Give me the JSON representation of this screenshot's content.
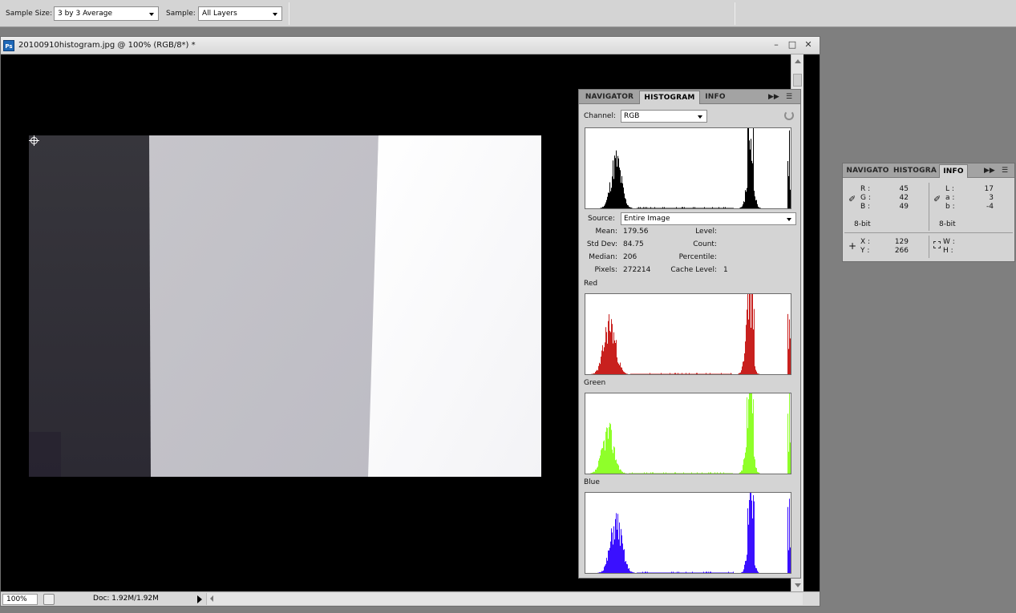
{
  "options_bar": {
    "sample_size_label": "Sample Size:",
    "sample_size_value": "3 by 3 Average",
    "sample_label": "Sample:",
    "sample_value": "All Layers"
  },
  "document": {
    "title": "20100910histogram.jpg @ 100% (RGB/8*) *",
    "app_icon": "Ps",
    "zoom": "100%",
    "doc_info": "Doc: 1.92M/1.92M"
  },
  "histogram_panel": {
    "tabs": [
      "NAVIGATOR",
      "HISTOGRAM",
      "INFO"
    ],
    "active_tab": "HISTOGRAM",
    "channel_label": "Channel:",
    "channel_value": "RGB",
    "source_label": "Source:",
    "source_value": "Entire Image",
    "stats": {
      "mean_label": "Mean:",
      "mean": "179.56",
      "stddev_label": "Std Dev:",
      "stddev": "84.75",
      "median_label": "Median:",
      "median": "206",
      "pixels_label": "Pixels:",
      "pixels": "272214",
      "level_label": "Level:",
      "count_label": "Count:",
      "percentile_label": "Percentile:",
      "cache_label": "Cache Level:",
      "cache": "1"
    },
    "channel_titles": {
      "red": "Red",
      "green": "Green",
      "blue": "Blue"
    },
    "colors": {
      "rgb": "#000000",
      "red": "#c8201e",
      "green": "#8fff2a",
      "blue": "#3a10ff"
    }
  },
  "info_panel": {
    "tabs": [
      "NAVIGATO",
      "HISTOGRA",
      "INFO"
    ],
    "active_tab": "INFO",
    "rgb": {
      "r_label": "R :",
      "r": "45",
      "g_label": "G :",
      "g": "42",
      "b_label": "B :",
      "b": "49",
      "depth": "8-bit"
    },
    "lab": {
      "l_label": "L :",
      "l": "17",
      "a_label": "a :",
      "a": "3",
      "b_label": "b :",
      "b": "-4",
      "depth": "8-bit"
    },
    "pos": {
      "x_label": "X :",
      "x": "129",
      "y_label": "Y :",
      "y": "266"
    },
    "size": {
      "w_label": "W :",
      "h_label": "H :"
    }
  }
}
